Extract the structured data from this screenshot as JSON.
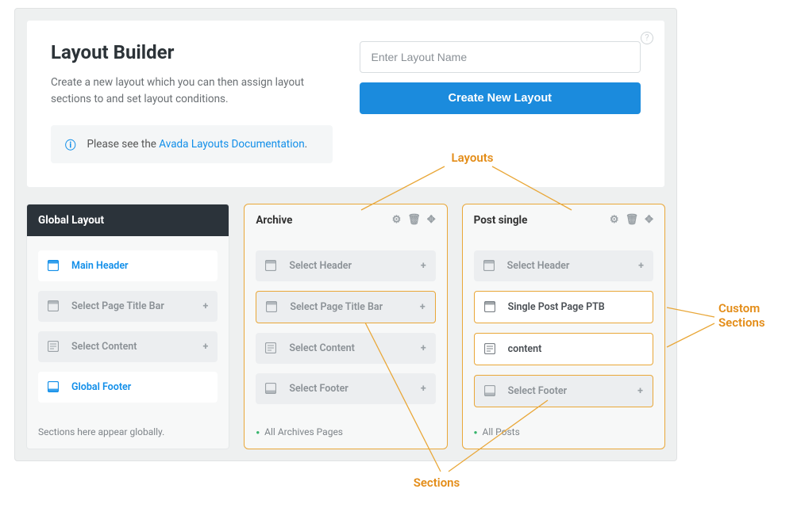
{
  "header": {
    "title": "Layout Builder",
    "subtitle": "Create a new layout which you can then assign layout sections to and set layout conditions.",
    "notice_prefix": "Please see the ",
    "notice_link": "Avada Layouts Documentation",
    "notice_suffix": ".",
    "input_placeholder": "Enter Layout Name",
    "create_button": "Create New Layout"
  },
  "annotations": {
    "layouts": "Layouts",
    "sections": "Sections",
    "custom_sections": "Custom Sections"
  },
  "columns": {
    "global": {
      "title": "Global Layout",
      "items": [
        {
          "label": "Main Header"
        },
        {
          "label": "Select Page Title Bar"
        },
        {
          "label": "Select Content"
        },
        {
          "label": "Global Footer"
        }
      ],
      "footer": "Sections here appear globally."
    },
    "archive": {
      "title": "Archive",
      "items": [
        {
          "label": "Select Header"
        },
        {
          "label": "Select Page Title Bar"
        },
        {
          "label": "Select Content"
        },
        {
          "label": "Select Footer"
        }
      ],
      "footer": "All Archives Pages"
    },
    "post": {
      "title": "Post single",
      "items": [
        {
          "label": "Select Header"
        },
        {
          "label": "Single Post Page PTB"
        },
        {
          "label": "content"
        },
        {
          "label": "Select Footer"
        }
      ],
      "footer": "All Posts"
    }
  }
}
